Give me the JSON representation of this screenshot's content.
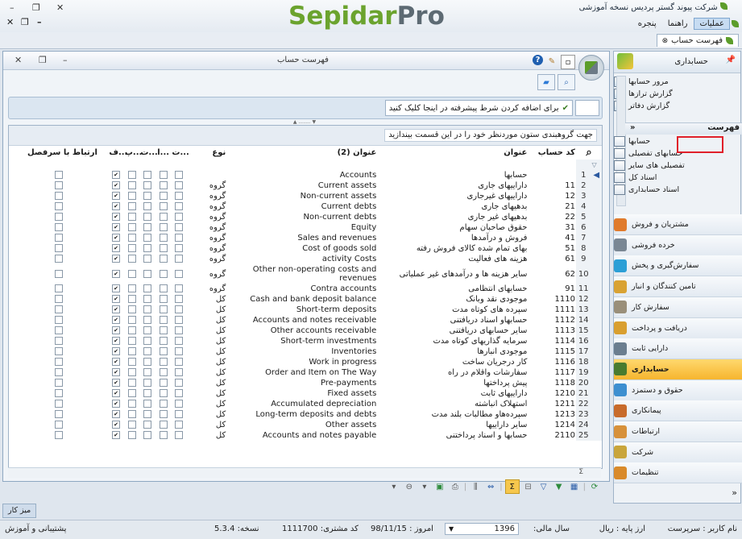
{
  "window": {
    "title": "شرکت پیوند گستر پردیس نسخه آموزشی",
    "logo_part1": "Sepidar",
    "logo_part2": "Pro",
    "close_glyph": "✕",
    "restore_glyph": "❐",
    "min_glyph": "–"
  },
  "menu": {
    "items": [
      "عملیات",
      "راهنما",
      "پنجره"
    ],
    "active_index": 0
  },
  "doc_tab": {
    "label": "فهرست حساب"
  },
  "main_window": {
    "title": "فهرست حساب",
    "filter_button_label": "برای اضافه کردن شرط پیشرفته در اینجا کلیک کنید",
    "group_hint": "جهت گروهبندی ستون موردنظر خود را در این قسمت بیندازید"
  },
  "grid": {
    "columns": {
      "code": "کد حساب",
      "title": "عنوان",
      "title2": "عنوان (2)",
      "type": "نوع",
      "c1": "ت...",
      "c2": "ت...",
      "c3": "ا...",
      "c4": "پ...",
      "c5": "ف...",
      "link": "ارتباط با سرفصل"
    },
    "rows": [
      {
        "n": "1",
        "code": "",
        "title": "حسابها",
        "title2": "Accounts",
        "type": "",
        "sel": true
      },
      {
        "n": "2",
        "code": "11",
        "title": "داراییهای جاری",
        "title2": "Current assets",
        "type": "گروه"
      },
      {
        "n": "3",
        "code": "12",
        "title": "داراییهای غیرجاری",
        "title2": "Non-current assets",
        "type": "گروه"
      },
      {
        "n": "4",
        "code": "21",
        "title": "بدهیهای جاری",
        "title2": "Current debts",
        "type": "گروه"
      },
      {
        "n": "5",
        "code": "22",
        "title": "بدهیهای غیر جاری",
        "title2": "Non-current debts",
        "type": "گروه"
      },
      {
        "n": "6",
        "code": "31",
        "title": "حقوق صاحبان سهام",
        "title2": "Equity",
        "type": "گروه"
      },
      {
        "n": "7",
        "code": "41",
        "title": "فروش و درآمدها",
        "title2": "Sales and revenues",
        "type": "گروه"
      },
      {
        "n": "8",
        "code": "51",
        "title": "بهای تمام شده کالای فروش رفته",
        "title2": "Cost of goods sold",
        "type": "گروه"
      },
      {
        "n": "9",
        "code": "61",
        "title": "هزینه های فعالیت",
        "title2": "activity Costs",
        "type": "گروه"
      },
      {
        "n": "10",
        "code": "62",
        "title": "سایر هزینه ها و درآمدهای غیر عملیاتی",
        "title2": "Other non-operating costs and revenues",
        "type": "گروه"
      },
      {
        "n": "11",
        "code": "91",
        "title": "حسابهای انتظامی",
        "title2": "Contra accounts",
        "type": "گروه"
      },
      {
        "n": "12",
        "code": "1110",
        "title": "موجودی نقد وبانک",
        "title2": "Cash and bank deposit balance",
        "type": "کل"
      },
      {
        "n": "13",
        "code": "1111",
        "title": "سپرده های کوتاه مدت",
        "title2": "Short-term deposits",
        "type": "کل"
      },
      {
        "n": "14",
        "code": "1112",
        "title": "حسابهاو اسناد دریافتنی",
        "title2": "Accounts and notes receivable",
        "type": "کل"
      },
      {
        "n": "15",
        "code": "1113",
        "title": "سایر حسابهای دریافتنی",
        "title2": "Other accounts receivable",
        "type": "کل"
      },
      {
        "n": "16",
        "code": "1114",
        "title": "سرمایه گذاریهای کوتاه مدت",
        "title2": "Short-term investments",
        "type": "کل"
      },
      {
        "n": "17",
        "code": "1115",
        "title": "موجودی انبارها",
        "title2": "Inventories",
        "type": "کل"
      },
      {
        "n": "18",
        "code": "1116",
        "title": "کار درجریان ساخت",
        "title2": "Work in progress",
        "type": "کل"
      },
      {
        "n": "19",
        "code": "1117",
        "title": "سفارشات واقلام در راه",
        "title2": "Order and Item on The Way",
        "type": "کل"
      },
      {
        "n": "20",
        "code": "1118",
        "title": "پیش پرداختها",
        "title2": "Pre-payments",
        "type": "کل"
      },
      {
        "n": "21",
        "code": "1210",
        "title": "داراییهای ثابت",
        "title2": "Fixed assets",
        "type": "کل"
      },
      {
        "n": "22",
        "code": "1211",
        "title": "استهلاک انباشته",
        "title2": "Accumulated depreciation",
        "type": "کل"
      },
      {
        "n": "23",
        "code": "1213",
        "title": "سپرده‌هاو مطالبات بلند مدت",
        "title2": "Long-term deposits and debts",
        "type": "کل"
      },
      {
        "n": "24",
        "code": "1214",
        "title": "سایر داراییها",
        "title2": "Other assets",
        "type": "کل"
      },
      {
        "n": "25",
        "code": "2110",
        "title": "حسابها و اسناد پرداختنی",
        "title2": "Accounts and notes payable",
        "type": "کل"
      }
    ],
    "footer_sum_glyph": "Σ"
  },
  "nav": {
    "header": "حسابداری",
    "reports": [
      "مرور حسابها",
      "گزارش ترازها",
      "گزارش دفاتر"
    ],
    "list_header": "فهرست",
    "list_items": [
      "حسابها",
      "حسابهای تفصیلی",
      "تفصیلی های سایر",
      "اسناد کل",
      "اسناد حسابداری"
    ],
    "categories": [
      {
        "label": "مشتریان و فروش",
        "color": "#e07b2c"
      },
      {
        "label": "خرده فروشی",
        "color": "#7a8794"
      },
      {
        "label": "سفارش‌گیری و پخش",
        "color": "#2c9fd6"
      },
      {
        "label": "تامین کنندگان و انبار",
        "color": "#d9a233"
      },
      {
        "label": "سفارش کار",
        "color": "#9a8f7a"
      },
      {
        "label": "دریافت و پرداخت",
        "color": "#d99f2f"
      },
      {
        "label": "دارایی ثابت",
        "color": "#6b7e8f"
      },
      {
        "label": "حسابداری",
        "color": "#4a7b2e",
        "active": true
      },
      {
        "label": "حقوق و دستمزد",
        "color": "#3d8fd0"
      },
      {
        "label": "پیمانکاری",
        "color": "#c86b2b"
      },
      {
        "label": "ارتباطات",
        "color": "#d7913a"
      },
      {
        "label": "شرکت",
        "color": "#c9a53b"
      },
      {
        "label": "تنظیمات",
        "color": "#d98a2a"
      }
    ]
  },
  "desk_tab": "میز کار",
  "status": {
    "user": "نام کاربر : سرپرست",
    "currency": "ارز پایه : ریال",
    "fiscal_year_label": "سال مالی:",
    "fiscal_year": "1396",
    "today": "امروز : 98/11/15",
    "customer_code": "کد مشتری: 1111700",
    "version": "نسخه: 5.3.4",
    "support": "پشتیبانی و آموزش"
  }
}
